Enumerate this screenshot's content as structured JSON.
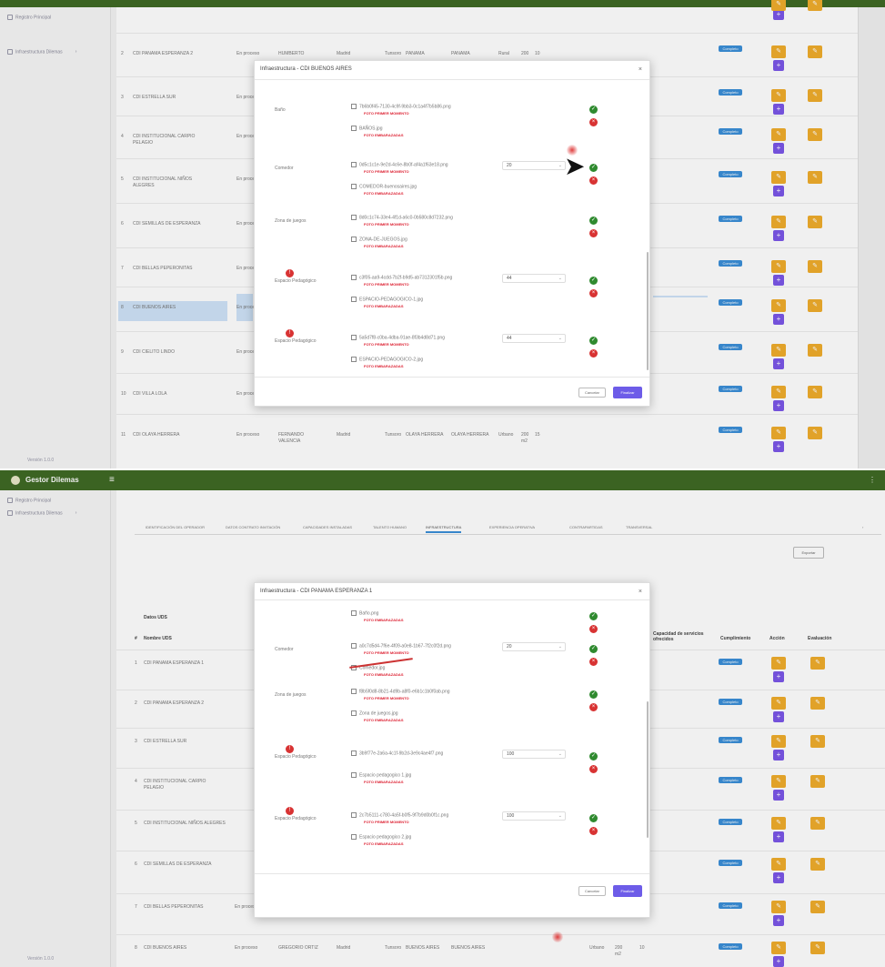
{
  "app": {
    "brand": "Gestor Dilemas"
  },
  "sidebar": {
    "items": [
      "Registro Principal",
      "Infraestructura Dilemas"
    ],
    "footer": "Versión 1.0.0"
  },
  "top": {
    "modal": {
      "title": "Infraestructura - CDI BUENOS AIRES",
      "sections": [
        {
          "label": "Baño",
          "files": [
            {
              "name": "7b6b0f45-7130-4c9f-9bb3-0c1a4f7b5b86.png",
              "status": "FOTO PRIMER MOMENTO"
            },
            {
              "name": "BAÑOS.jpg",
              "status": "FOTO EMBARAZADAS"
            }
          ],
          "select": ""
        },
        {
          "label": "Comedor",
          "files": [
            {
              "name": "0d5c1c1e-9e2d-4c6e-8b0f-af4a1f63e18.png",
              "status": "FOTO PRIMER MOMENTO"
            },
            {
              "name": "COMEDOR-buenosaires.jpg",
              "status": "FOTO EMBARAZADAS"
            }
          ],
          "select": "20"
        },
        {
          "label": "Zona de juegos",
          "files": [
            {
              "name": "8d0c1c74-33e4-4f1d-a6c0-0b580c8d7232.png",
              "status": "FOTO PRIMER MOMENTO"
            },
            {
              "name": "ZONA-DE-JUEGOS.jpg",
              "status": "FOTO EMBARAZADAS"
            }
          ],
          "select": ""
        },
        {
          "label": "Espacio Pedagógico",
          "files": [
            {
              "name": "c3f05-aa9-4cdd-7b2f-b9d5-ab7312301f5b.png",
              "status": "FOTO PRIMER MOMENTO"
            },
            {
              "name": "ESPACIO-PEDAGOGICO-1.jpg",
              "status": "FOTO EMBARAZADAS"
            }
          ],
          "select": "44"
        },
        {
          "label": "Espacio Pedagógico",
          "files": [
            {
              "name": "5a5d7f8-c0ba-4dba-91ae-8f3b4d8d71.png",
              "status": "FOTO PRIMER MOMENTO"
            },
            {
              "name": "ESPACIO-PEDAGOGICO-2.jpg",
              "status": "FOTO EMBARAZADAS"
            }
          ],
          "select": "44"
        }
      ],
      "cancel_label": "Cancelar",
      "final_label": "Finalizar"
    },
    "rows": [
      {
        "num": "2",
        "name": "CDI PANAMA ESPERANZA 2",
        "mod": "En proceso",
        "resp": "HUMBERTO",
        "a": "Madrid",
        "b": "Tunsoro",
        "c": "PANAMA",
        "d": "PANAMA",
        "e": "Rural",
        "f": "200",
        "g": "10"
      },
      {
        "num": "3",
        "name": "CDI ESTRELLA SUR",
        "mod": "En proceso"
      },
      {
        "num": "4",
        "name": "CDI INSTITUCIONAL CARPIO PELAGIO",
        "mod": "En proceso"
      },
      {
        "num": "5",
        "name": "CDI INSTITUCIONAL NIÑOS ALEGRES",
        "mod": "En proceso"
      },
      {
        "num": "6",
        "name": "CDI SEMILLAS DE ESPERANZA",
        "mod": "En proceso"
      },
      {
        "num": "7",
        "name": "CDI BELLAS PEPERONITAS",
        "mod": "En proceso"
      },
      {
        "num": "8",
        "name": "CDI BUENOS AIRES",
        "mod": "En proceso"
      },
      {
        "num": "9",
        "name": "CDI CIELITO LINDO",
        "mod": "En proceso"
      },
      {
        "num": "10",
        "name": "CDI VILLA LOLA",
        "mod": "En proceso"
      },
      {
        "num": "11",
        "name": "CDI OLAYA HERRERA",
        "mod": "En proceso",
        "resp": "FERNANDO VALENCIA",
        "a": "Madrid",
        "b": "Tunsoro",
        "c": "OLAYA HERRERA",
        "d": "OLAYA HERRERA",
        "e": "Urbano",
        "f": "200 m2",
        "g": "15"
      }
    ],
    "badge_label": "Completo"
  },
  "bottom": {
    "tabs": [
      "IDENTIFICACIÓN DEL OPERADOR",
      "DATOS CONTRATO INVITACIÓN",
      "CAPACIDADES INSTALADAS",
      "TALENTO HUMANO",
      "INFRAESTRUCTURA",
      "EXPERIENCIA OPERATIVA",
      "CONTRAPARTIDAS",
      "TRANSVERSAL"
    ],
    "export_label": "Exportar",
    "table_title": "Datos UDS",
    "headers": {
      "num": "#",
      "name": "Nombre UDS",
      "capacity": "Capacidad de servicios ofrecidos",
      "status": "Cumplimiento",
      "action": "Acción",
      "eval": "Evaluación"
    },
    "rows": [
      {
        "num": "1",
        "name": "CDI PANAMA ESPERANZA 1"
      },
      {
        "num": "2",
        "name": "CDI PANAMA ESPERANZA 2"
      },
      {
        "num": "3",
        "name": "CDI ESTRELLA SUR"
      },
      {
        "num": "4",
        "name": "CDI INSTITUCIONAL CARPIO PELAGIO"
      },
      {
        "num": "5",
        "name": "CDI INSTITUCIONAL NIÑOS ALEGRES"
      },
      {
        "num": "6",
        "name": "CDI SEMILLAS DE ESPERANZA"
      },
      {
        "num": "7",
        "name": "CDI BELLAS PEPERONITAS",
        "mod": "En proceso",
        "resp": "FERNANDO VALENCIA"
      },
      {
        "num": "8",
        "name": "CDI BUENOS AIRES",
        "mod": "En proceso",
        "resp": "GREGORIO ORTIZ",
        "a": "Madrid",
        "b": "Tunsoro",
        "c": "BUENOS AIRES",
        "d": "BUENOS AIRES",
        "e": "Urbano",
        "f": "200 m2",
        "g": "10"
      }
    ],
    "modal": {
      "title": "Infraestructura - CDI PANAMA ESPERANZA 1",
      "sections": [
        {
          "label": "",
          "files": [
            {
              "name": "Baño.png",
              "status": "FOTO EMBARAZADAS"
            }
          ],
          "select": ""
        },
        {
          "label": "Comedor",
          "files": [
            {
              "name": "a0c7d5d4-7f6e-4f09-a0e8-1b67-7f2c0f2d.png",
              "status": "FOTO PRIMER MOMENTO"
            },
            {
              "name": "Comedor.jpg",
              "status": "FOTO EMBARAZADAS"
            }
          ],
          "select": "20"
        },
        {
          "label": "Zona de juegos",
          "files": [
            {
              "name": "f8b5f0d8-8b21-4d9b-a8f0-e6b1c1b0f0ab.png",
              "status": "FOTO PRIMER MOMENTO"
            },
            {
              "name": "Zona de juegos.jpg",
              "status": "FOTO EMBARAZADAS"
            }
          ],
          "select": ""
        },
        {
          "label": "Espacio Pedagógico",
          "files": [
            {
              "name": "3b9f77e-2a6a-4c1f-9b2d-3e9c4ae4f7.png",
              "status": ""
            },
            {
              "name": "Espacio pedagogico 1.jpg",
              "status": "FOTO EMBARAZADAS"
            }
          ],
          "select": "100"
        },
        {
          "label": "Espacio Pedagógico",
          "files": [
            {
              "name": "2c7b5111-c780-4a5f-b0f5-9f7b9d0b0f1c.png",
              "status": "FOTO PRIMER MOMENTO"
            },
            {
              "name": "Espacio pedagogico 2.jpg",
              "status": "FOTO EMBARAZADAS"
            }
          ],
          "select": "100"
        }
      ],
      "cancel_label": "Cancelar",
      "final_label": "Finalizar"
    }
  },
  "colors": {
    "header": "#3f6a25",
    "badge": "#3b8fd8",
    "action": "#f0ad2c",
    "add": "#7b57e8",
    "ok": "#2f8a2f",
    "no": "#d83333"
  }
}
